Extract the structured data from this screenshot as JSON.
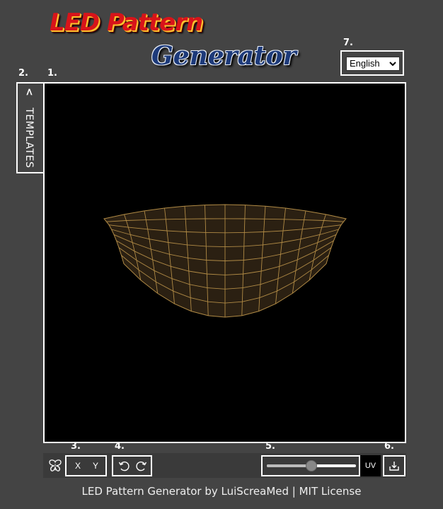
{
  "header": {
    "logo_line1": "LED Pattern",
    "logo_line2": "Generator"
  },
  "markers": {
    "canvas": "1.",
    "templates": "2.",
    "mirror": "3.",
    "undo_redo": "4.",
    "slider": "5.",
    "export": "6.",
    "language": "7."
  },
  "language_select": {
    "selected": "English"
  },
  "sidebar": {
    "templates_label": "TEMPLATES",
    "toggle_glyph": "<"
  },
  "toolbar": {
    "mirror_icon": "butterfly-icon",
    "flip_x_label": "X",
    "flip_y_label": "Y",
    "undo_icon": "undo-icon",
    "redo_icon": "redo-icon",
    "slider_value_fraction": 0.5,
    "uv_label": "UV",
    "export_icon": "download-icon"
  },
  "canvas": {
    "background": "#000000",
    "mesh_fill": "#2b2012",
    "mesh_line": "#b08a45"
  },
  "footer": {
    "text": "LED Pattern Generator by LuiScreaMed | MIT License"
  }
}
